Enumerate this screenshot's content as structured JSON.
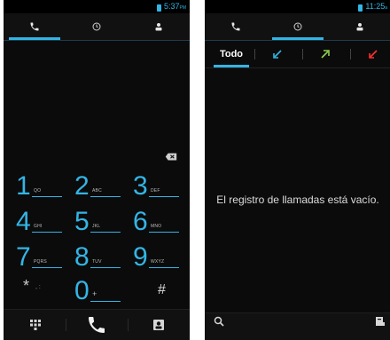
{
  "dialer": {
    "statusbar": {
      "time": "5:37",
      "ampm": "PM"
    },
    "tabs": [
      {
        "name": "phone",
        "icon": "phone-icon",
        "active": true
      },
      {
        "name": "recent",
        "icon": "clock-icon",
        "active": false
      },
      {
        "name": "contacts",
        "icon": "contact-icon",
        "active": false
      }
    ],
    "keys": [
      {
        "digit": "1",
        "letters": "QO"
      },
      {
        "digit": "2",
        "letters": "ABC"
      },
      {
        "digit": "3",
        "letters": "DEF"
      },
      {
        "digit": "4",
        "letters": "GHI"
      },
      {
        "digit": "5",
        "letters": "JKL"
      },
      {
        "digit": "6",
        "letters": "MNO"
      },
      {
        "digit": "7",
        "letters": "PQRS"
      },
      {
        "digit": "8",
        "letters": "TUV"
      },
      {
        "digit": "9",
        "letters": "WXYZ"
      },
      {
        "digit": "0",
        "letters": "+"
      }
    ],
    "star": "*",
    "star_extra": ",  :",
    "hash": "#",
    "bottom_icons": [
      "dialpad-icon",
      "call-icon",
      "add-contact-icon"
    ]
  },
  "calllog": {
    "statusbar": {
      "time": "11:25",
      "ampm": "a"
    },
    "tabs": [
      {
        "name": "phone",
        "icon": "phone-icon",
        "active": false
      },
      {
        "name": "recent",
        "icon": "clock-icon",
        "active": true
      },
      {
        "name": "contacts",
        "icon": "contact-icon",
        "active": false
      }
    ],
    "filters": [
      {
        "label": "Todo",
        "active": true
      },
      {
        "icon": "incoming-call-icon",
        "color": "#33b5e5"
      },
      {
        "icon": "outgoing-call-icon",
        "color": "#8fd14f"
      },
      {
        "icon": "missed-call-icon",
        "color": "#ff3030"
      }
    ],
    "empty_message": "El registro de llamadas está vacío.",
    "bottom_icons": [
      "search-icon",
      "menu-icon"
    ]
  },
  "colors": {
    "accent": "#33b5e5",
    "background": "#0b0b0b"
  }
}
